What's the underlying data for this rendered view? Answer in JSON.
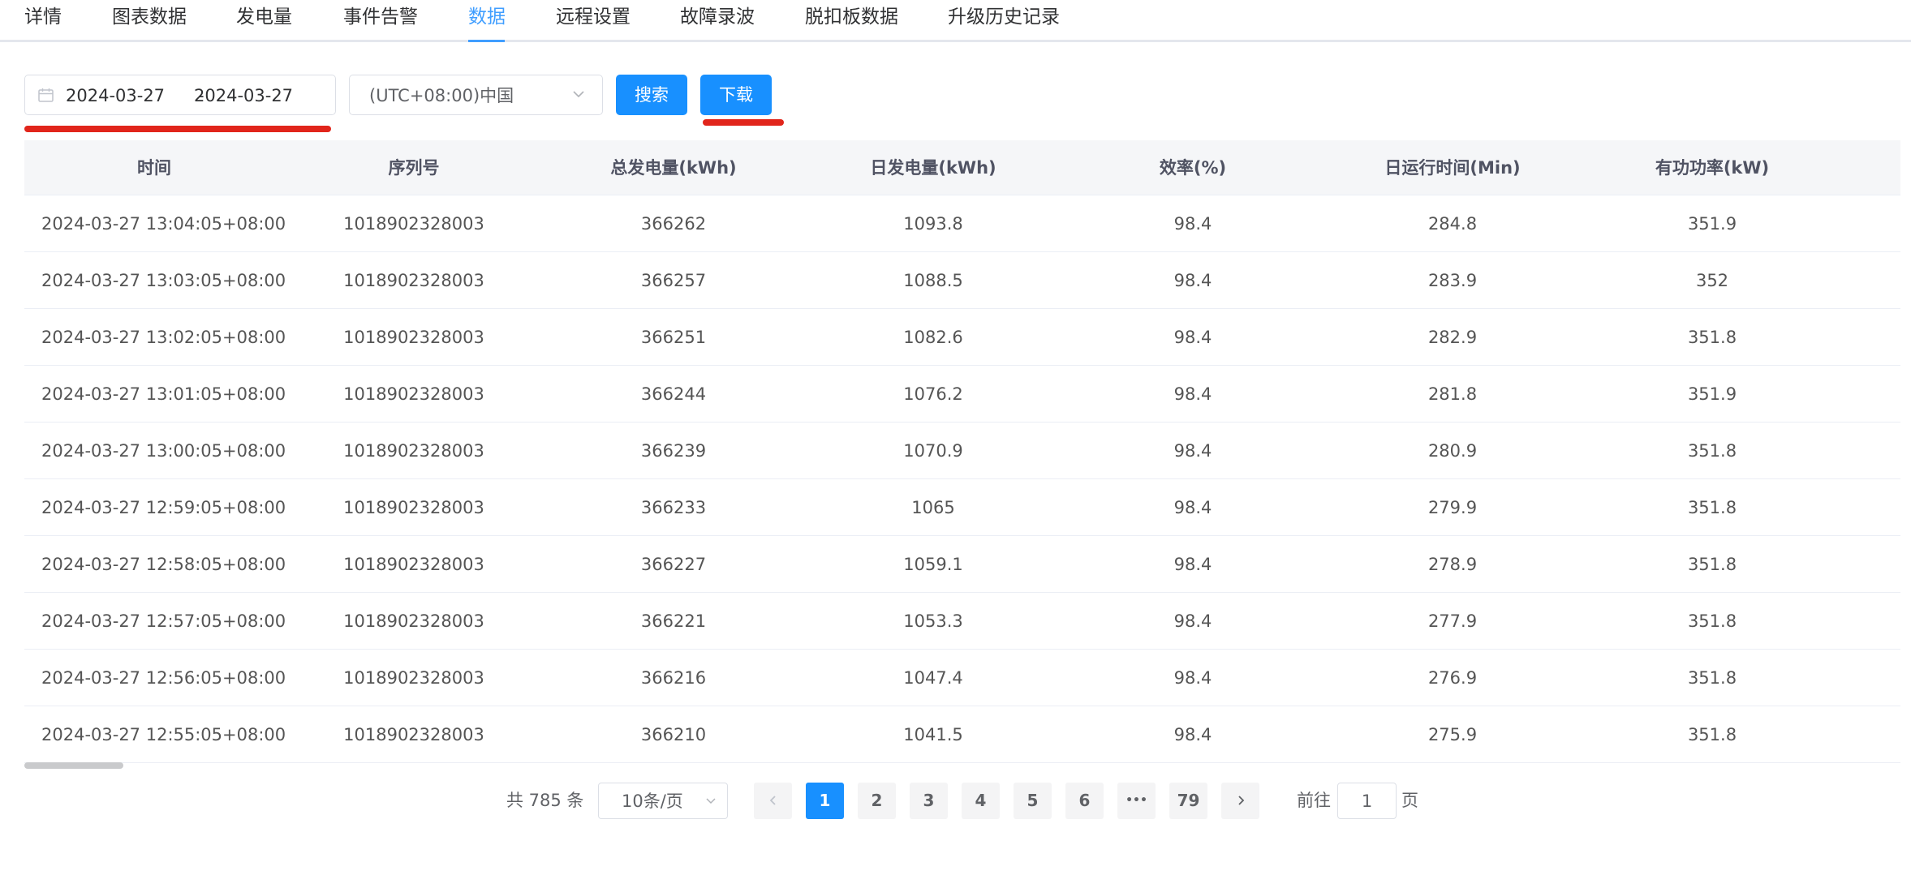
{
  "tabs": [
    {
      "label": "详情"
    },
    {
      "label": "图表数据"
    },
    {
      "label": "发电量"
    },
    {
      "label": "事件告警"
    },
    {
      "label": "数据",
      "active": true
    },
    {
      "label": "远程设置"
    },
    {
      "label": "故障录波"
    },
    {
      "label": "脱扣板数据"
    },
    {
      "label": "升级历史记录"
    }
  ],
  "toolbar": {
    "date_start": "2024-03-27",
    "date_separator": "-",
    "date_end": "2024-03-27",
    "timezone": "(UTC+08:00)中国",
    "search_label": "搜索",
    "download_label": "下载",
    "accent_color": "#1890ff",
    "annotation_color": "#e1251b"
  },
  "table": {
    "columns": [
      "时间",
      "序列号",
      "总发电量(kWh)",
      "日发电量(kWh)",
      "效率(%)",
      "日运行时间(Min)",
      "有功功率(kW)"
    ],
    "rows": [
      [
        "2024-03-27 13:04:05+08:00",
        "1018902328003",
        "366262",
        "1093.8",
        "98.4",
        "284.8",
        "351.9"
      ],
      [
        "2024-03-27 13:03:05+08:00",
        "1018902328003",
        "366257",
        "1088.5",
        "98.4",
        "283.9",
        "352"
      ],
      [
        "2024-03-27 13:02:05+08:00",
        "1018902328003",
        "366251",
        "1082.6",
        "98.4",
        "282.9",
        "351.8"
      ],
      [
        "2024-03-27 13:01:05+08:00",
        "1018902328003",
        "366244",
        "1076.2",
        "98.4",
        "281.8",
        "351.9"
      ],
      [
        "2024-03-27 13:00:05+08:00",
        "1018902328003",
        "366239",
        "1070.9",
        "98.4",
        "280.9",
        "351.8"
      ],
      [
        "2024-03-27 12:59:05+08:00",
        "1018902328003",
        "366233",
        "1065",
        "98.4",
        "279.9",
        "351.8"
      ],
      [
        "2024-03-27 12:58:05+08:00",
        "1018902328003",
        "366227",
        "1059.1",
        "98.4",
        "278.9",
        "351.8"
      ],
      [
        "2024-03-27 12:57:05+08:00",
        "1018902328003",
        "366221",
        "1053.3",
        "98.4",
        "277.9",
        "351.8"
      ],
      [
        "2024-03-27 12:56:05+08:00",
        "1018902328003",
        "366216",
        "1047.4",
        "98.4",
        "276.9",
        "351.8"
      ],
      [
        "2024-03-27 12:55:05+08:00",
        "1018902328003",
        "366210",
        "1041.5",
        "98.4",
        "275.9",
        "351.8"
      ]
    ]
  },
  "pagination": {
    "total_label": "共 785 条",
    "page_size": "10条/页",
    "pages": [
      "1",
      "2",
      "3",
      "4",
      "5",
      "6",
      "•••",
      "79"
    ],
    "current_page": "1",
    "goto_label": "前往",
    "goto_value": "1",
    "page_suffix": "页"
  }
}
